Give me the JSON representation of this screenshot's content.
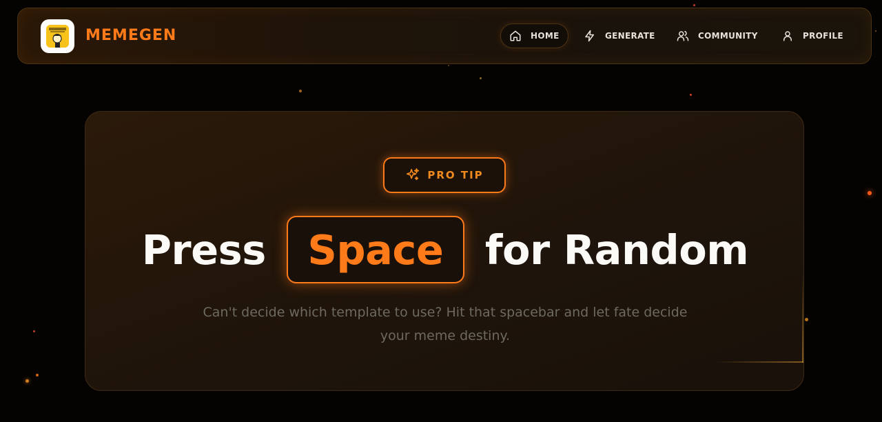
{
  "app": {
    "brand": "MEMEGEN"
  },
  "nav": {
    "items": [
      {
        "label": "HOME",
        "icon": "home-icon",
        "active": true
      },
      {
        "label": "GENERATE",
        "icon": "bolt-icon",
        "active": false
      },
      {
        "label": "COMMUNITY",
        "icon": "users-icon",
        "active": false
      },
      {
        "label": "PROFILE",
        "icon": "user-icon",
        "active": false
      }
    ]
  },
  "hero": {
    "badge": "PRO TIP",
    "badge_icon": "sparkles-icon",
    "headline_pre": "Press",
    "headline_key": "Space",
    "headline_post": "for Random",
    "subtext": "Can't decide which template to use? Hit that spacebar and let fate decide your meme destiny."
  },
  "colors": {
    "accent": "#ff7a18",
    "background": "#040302",
    "text": "#fbfaf7",
    "muted": "#6d6a5f"
  }
}
